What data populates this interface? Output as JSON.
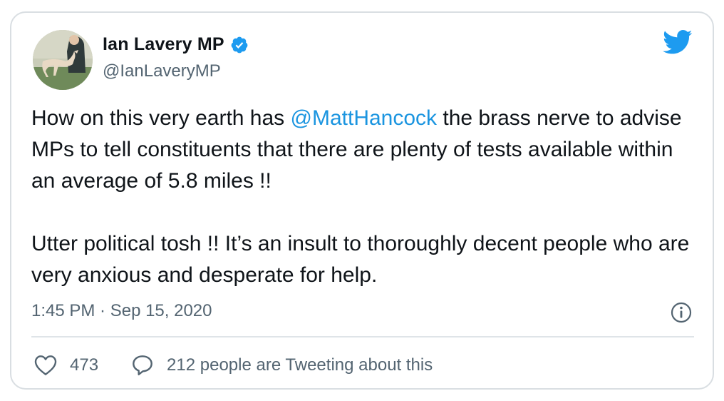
{
  "author": {
    "display_name": "Ian Lavery MP",
    "handle": "@IanLaveryMP",
    "verified": true,
    "avatar_icon": "greyhound-painting-avatar"
  },
  "brand": {
    "logo_icon": "twitter-bird-icon",
    "accent_color": "#1b95e0"
  },
  "tweet": {
    "paragraph1": {
      "before_mention": "How on this very earth has ",
      "mention": "@MattHancock",
      "after_mention": " the brass nerve to advise MPs to tell constituents that there are plenty of tests available within an average of 5.8 miles !!"
    },
    "paragraph2": "Utter political tosh !! It’s an insult to thoroughly decent people who are very anxious and desperate for help.",
    "timestamp": "1:45 PM · Sep 15, 2020"
  },
  "actions": {
    "likes_count": "473",
    "conversation_label": "212 people are Tweeting about this"
  }
}
